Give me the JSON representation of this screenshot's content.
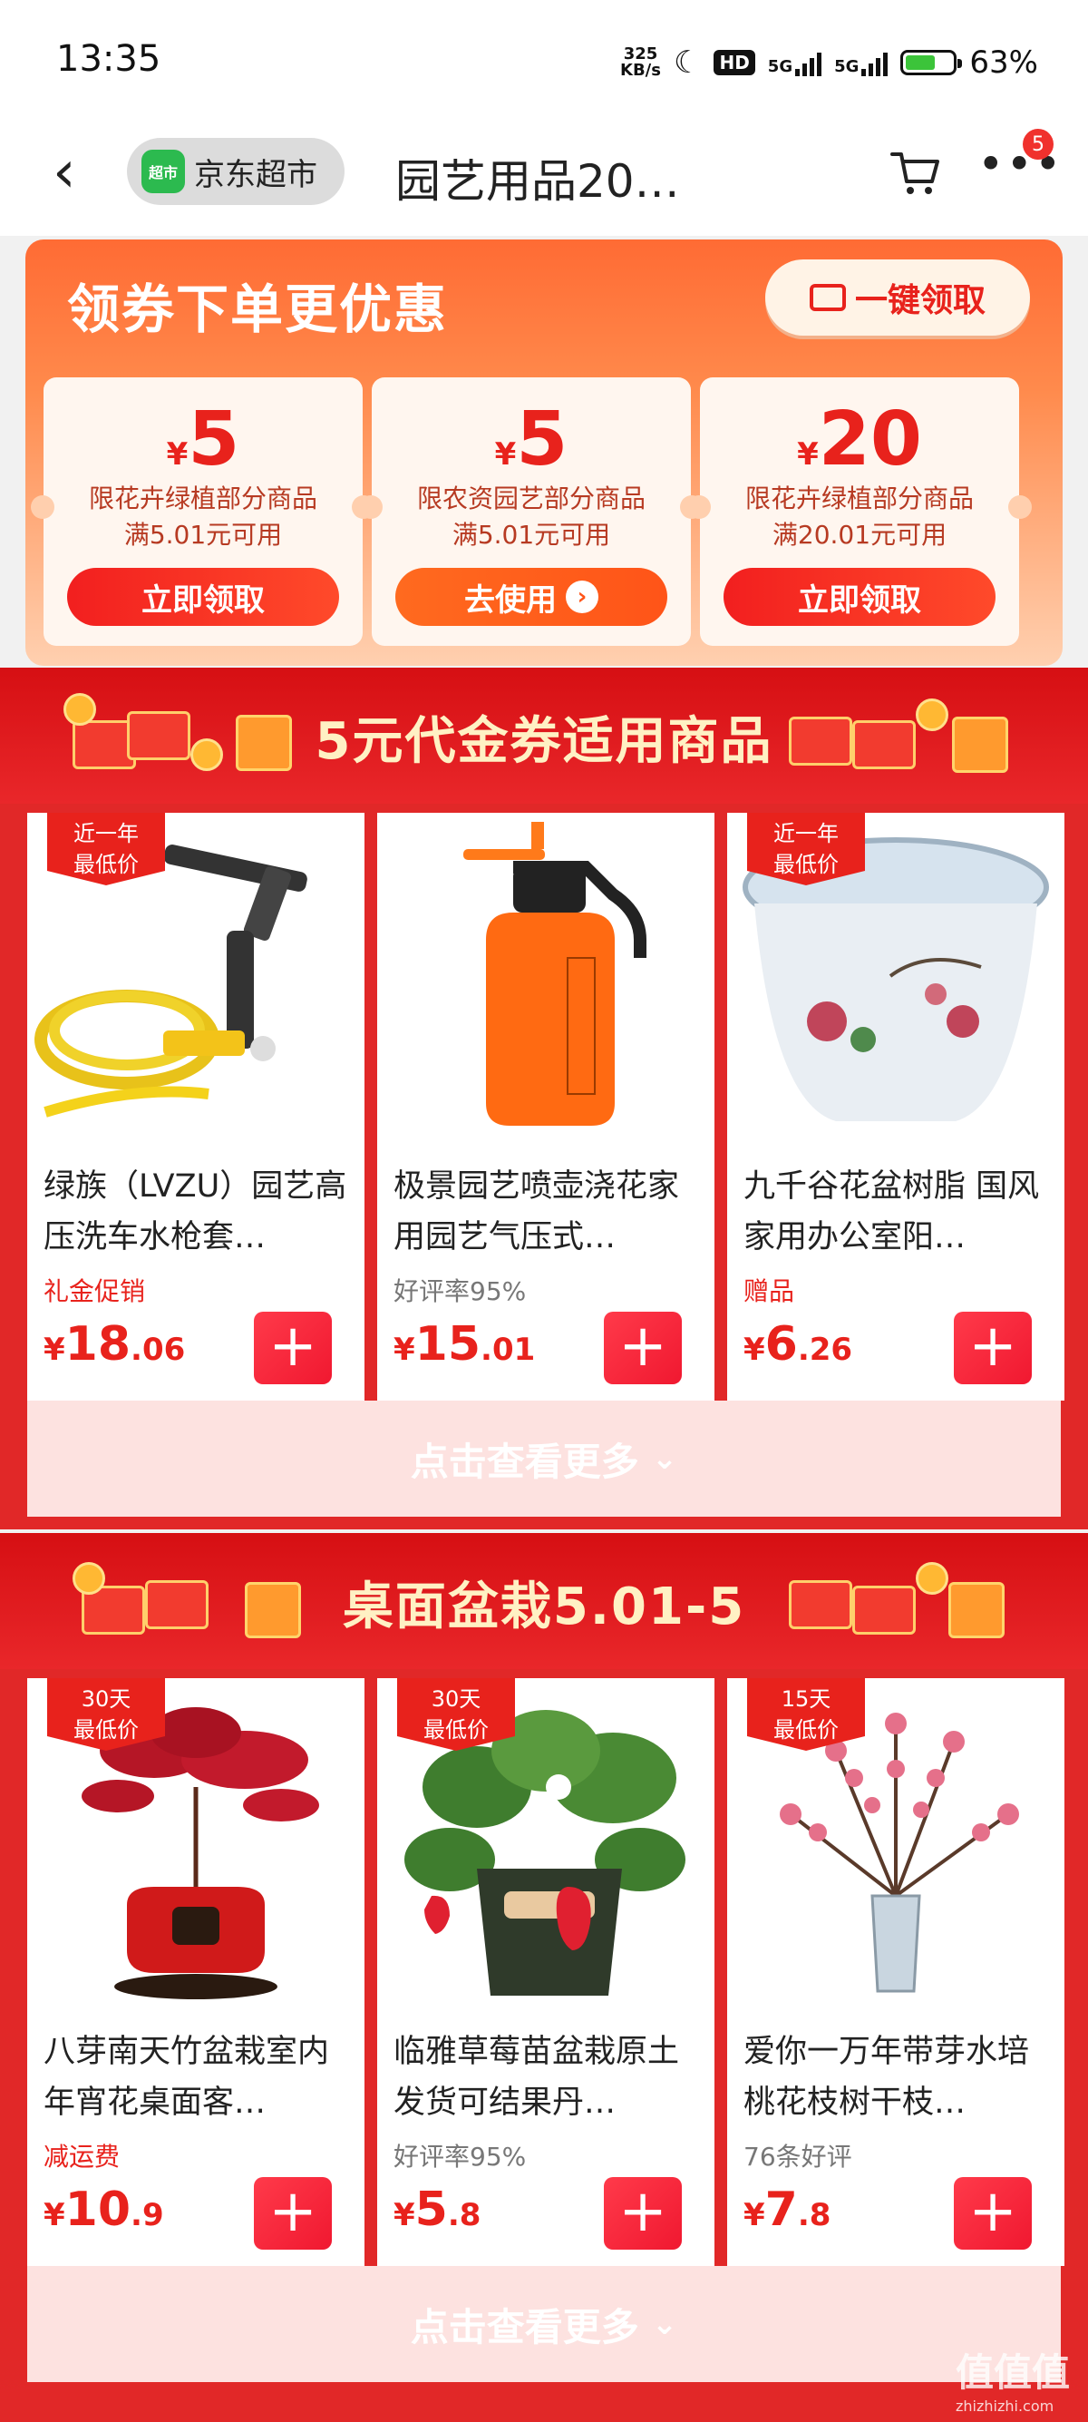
{
  "status_bar": {
    "time": "13:35",
    "speed_value": "325",
    "speed_unit": "KB/s",
    "hd_label": "HD",
    "net1": "5G",
    "net2": "5G",
    "battery_pct": "63%",
    "battery_level": 0.63
  },
  "nav": {
    "back_icon": "chevron-left-icon",
    "store_logo_text": "超市",
    "store_name": "京东超市",
    "title": "园艺用品20…",
    "cart_icon": "cart-icon",
    "more_icon": "more-icon",
    "badge_count": "5"
  },
  "coupon_panel": {
    "heading": "领券下单更优惠",
    "one_click_label": "一键领取",
    "coupons": [
      {
        "currency": "¥",
        "amount": "5",
        "cond1": "限花卉绿植部分商品",
        "cond2": "满5.01元可用",
        "button": "立即领取"
      },
      {
        "currency": "¥",
        "amount": "5",
        "cond1": "限农资园艺部分商品",
        "cond2": "满5.01元可用",
        "button": "去使用"
      },
      {
        "currency": "¥",
        "amount": "20",
        "cond1": "限花卉绿植部分商品",
        "cond2": "满20.01元可用",
        "button": "立即领取"
      }
    ]
  },
  "sections": [
    {
      "title": "5元代金券适用商品",
      "see_more": "点击查看更多",
      "products": [
        {
          "tag1": "近一年",
          "tag2": "最低价",
          "name": "绿族（LVZU）园艺高压洗车水枪套…",
          "promo": "礼金促销",
          "price_yen": "¥",
          "price_int": "18",
          "price_dec": ".06"
        },
        {
          "tag1": "",
          "tag2": "",
          "name": "极景园艺喷壶浇花家用园艺气压式…",
          "promo": "好评率95%",
          "price_yen": "¥",
          "price_int": "15",
          "price_dec": ".01"
        },
        {
          "tag1": "近一年",
          "tag2": "最低价",
          "name": "九千谷花盆树脂 国风家用办公室阳…",
          "promo": "赠品",
          "price_yen": "¥",
          "price_int": "6",
          "price_dec": ".26"
        }
      ]
    },
    {
      "title": "桌面盆栽5.01-5",
      "see_more": "点击查看更多",
      "products": [
        {
          "tag1": "30天",
          "tag2": "最低价",
          "name": "八芽南天竹盆栽室内年宵花桌面客…",
          "promo": "减运费",
          "price_yen": "¥",
          "price_int": "10",
          "price_dec": ".9"
        },
        {
          "tag1": "30天",
          "tag2": "最低价",
          "name": "临雅草莓苗盆栽原土发货可结果丹…",
          "promo": "好评率95%",
          "price_yen": "¥",
          "price_int": "5",
          "price_dec": ".8"
        },
        {
          "tag1": "15天",
          "tag2": "最低价",
          "name": "爱你一万年带芽水培桃花枝树干枝…",
          "promo": "76条好评",
          "price_yen": "¥",
          "price_int": "7",
          "price_dec": ".8"
        }
      ]
    }
  ],
  "watermark": {
    "line1": "值值值",
    "line2": "zhizhizhi.com"
  },
  "colors": {
    "accent_red": "#e8221c",
    "banner_red": "#d60f13",
    "coupon_orange": "#ff6b34"
  }
}
